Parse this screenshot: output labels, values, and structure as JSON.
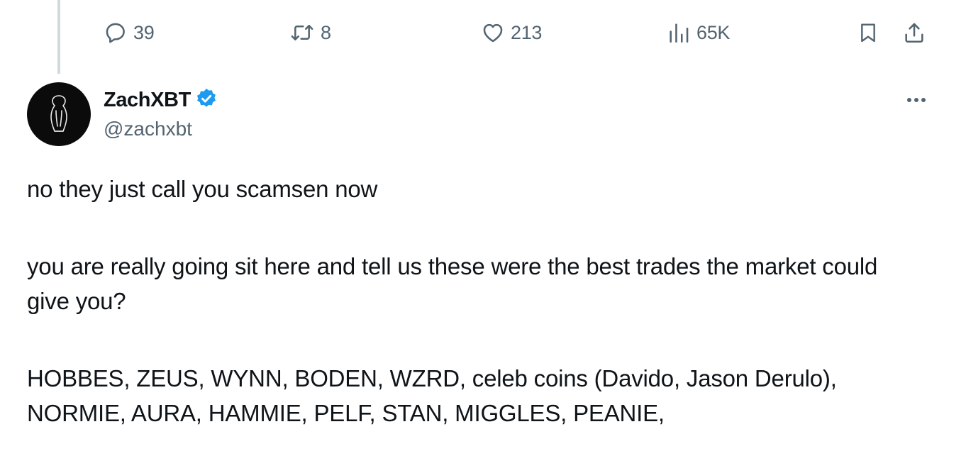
{
  "actions": {
    "replies": "39",
    "reposts": "8",
    "likes": "213",
    "views": "65K"
  },
  "icons": {
    "reply": "speech-bubble-icon",
    "repost": "repost-arrows-icon",
    "like": "heart-icon",
    "views": "bar-chart-icon",
    "bookmark": "bookmark-icon",
    "share": "share-upload-icon",
    "verified": "verified-check-badge-icon",
    "more": "more-dots-icon"
  },
  "author": {
    "display_name": "ZachXBT",
    "handle": "@zachxbt",
    "verified": true
  },
  "tweet": {
    "paragraphs": [
      "no they just call you scamsen now",
      "you are really going sit here and tell us these were the best trades the market could give you?",
      "HOBBES, ZEUS, WYNN, BODEN, WZRD, celeb coins (Davido, Jason Derulo), NORMIE, AURA, HAMMIE, PELF, STAN, MIGGLES, PEANIE,"
    ]
  },
  "colors": {
    "text_primary": "#0f1419",
    "text_secondary": "#536471",
    "verified_blue": "#1d9bf0",
    "thread_line": "#cfd9de"
  }
}
